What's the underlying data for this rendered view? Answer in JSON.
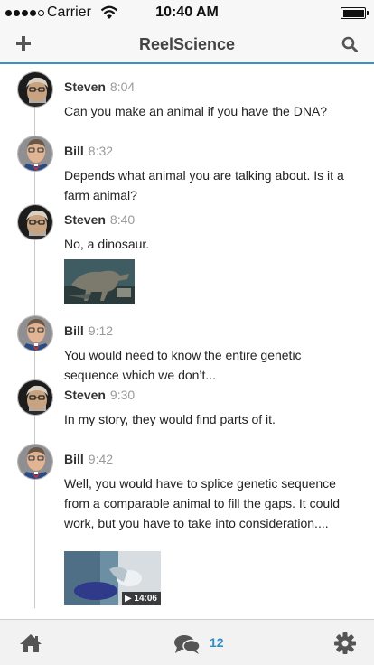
{
  "status_bar": {
    "carrier": "Carrier",
    "time": "10:40 AM",
    "signal_bars": 4,
    "signal_total": 5
  },
  "nav": {
    "title": "ReelScience",
    "left_icon": "plus-icon",
    "right_icon": "search-icon"
  },
  "messages": [
    {
      "author": "Steven",
      "time": "8:04",
      "text": "Can you make an animal if you have the DNA?",
      "avatar": "steven"
    },
    {
      "author": "Bill",
      "time": "8:32",
      "text": "Depends what animal you are talking about. Is it a farm animal?",
      "avatar": "bill"
    },
    {
      "author": "Steven",
      "time": "8:40",
      "text": "No, a dinosaur.",
      "avatar": "steven",
      "attachment": "image"
    },
    {
      "author": "Bill",
      "time": "9:12",
      "text": "You would need to know the entire genetic sequence which we don’t...",
      "avatar": "bill"
    },
    {
      "author": "Steven",
      "time": "9:30",
      "text": "In my story, they would find parts of it.",
      "avatar": "steven"
    },
    {
      "author": "Bill",
      "time": "9:42",
      "text": "Well, you would have to splice genetic sequence from a comparable animal to fill the gaps. It could work, but you have to take into consideration....",
      "avatar": "bill",
      "attachment": "video",
      "video_duration": "▶ 14:06"
    }
  ],
  "tab_bar": {
    "home_icon": "home-icon",
    "chat_icon": "chat-bubbles-icon",
    "chat_count": "12",
    "settings_icon": "gear-icon"
  },
  "colors": {
    "accent": "#2f8cc9",
    "nav_border": "#3d8ec9",
    "author": "#333333",
    "time": "#999999"
  }
}
